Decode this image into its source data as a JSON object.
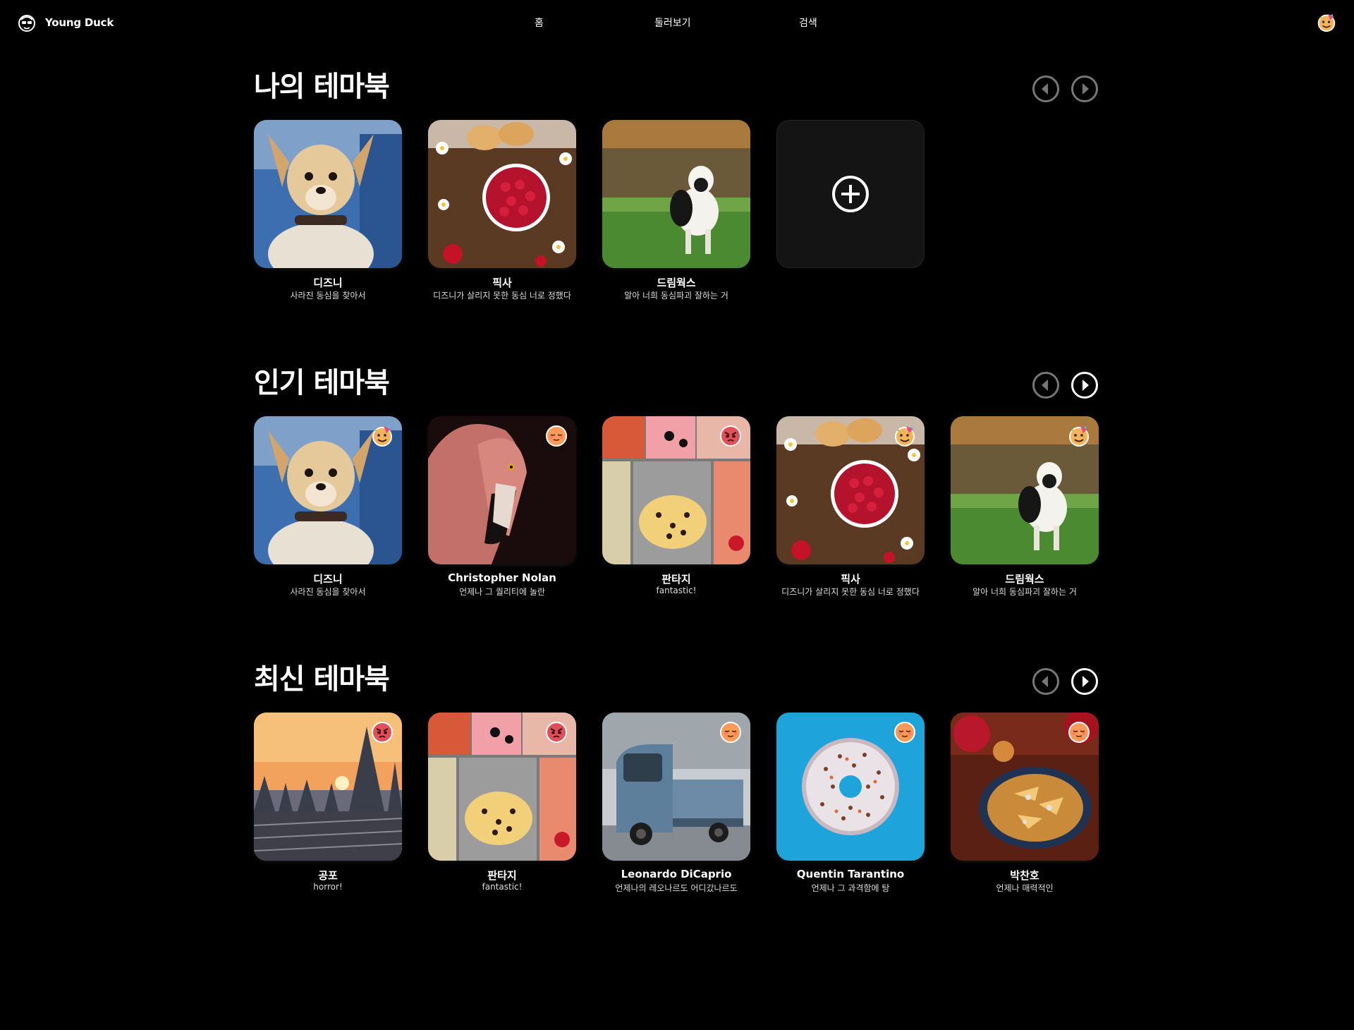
{
  "header": {
    "brand": "Young Duck",
    "nav": {
      "home": "홈",
      "explore": "둘러보기",
      "search": "검색"
    }
  },
  "sections": {
    "mine": {
      "title": "나의 테마북",
      "cards": [
        {
          "title": "디즈니",
          "subtitle": "사라진 동심을 찾아서"
        },
        {
          "title": "픽사",
          "subtitle": "디즈니가 살리지 못한 동심 너로 정했다"
        },
        {
          "title": "드림웍스",
          "subtitle": "알아 너희 동심파괴 잘하는 거"
        }
      ]
    },
    "popular": {
      "title": "인기 테마북",
      "cards": [
        {
          "title": "디즈니",
          "subtitle": "사라진 동심을 찾아서"
        },
        {
          "title": "Christopher Nolan",
          "subtitle": "언제나 그 퀄리티에 놀란"
        },
        {
          "title": "판타지",
          "subtitle": "fantastic!"
        },
        {
          "title": "픽사",
          "subtitle": "디즈니가 살리지 못한 동심 너로 정했다"
        },
        {
          "title": "드림웍스",
          "subtitle": "알아 너희 동심파괴 잘하는 거"
        }
      ]
    },
    "latest": {
      "title": "최신 테마북",
      "cards": [
        {
          "title": "공포",
          "subtitle": "horror!"
        },
        {
          "title": "판타지",
          "subtitle": "fantastic!"
        },
        {
          "title": "Leonardo DiCaprio",
          "subtitle": "언제나의 레오나르도 어디갔나르도"
        },
        {
          "title": "Quentin Tarantino",
          "subtitle": "언제나 그 과격함에 탕"
        },
        {
          "title": "박찬호",
          "subtitle": "언제나 매력적인"
        }
      ]
    }
  },
  "colors": {
    "background": "#000000",
    "add_card": "#141414",
    "arrow_disabled": "#777777",
    "arrow_enabled": "#ffffff"
  }
}
